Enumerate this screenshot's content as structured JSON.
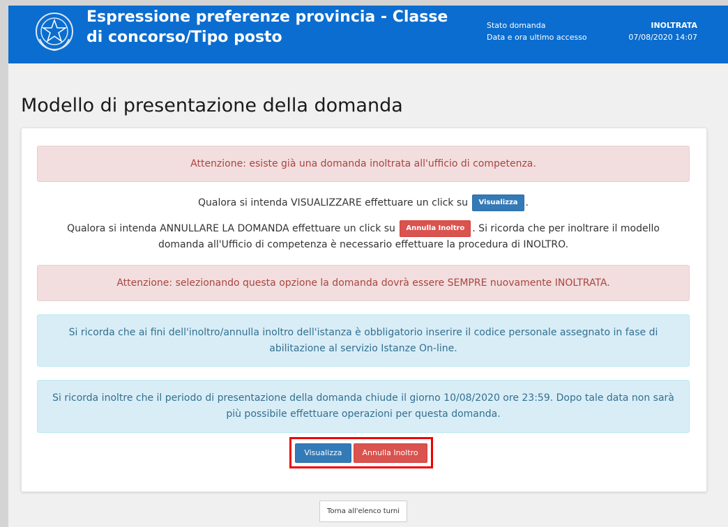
{
  "header": {
    "title": "Espressione preferenze provincia - Classe di concorso/Tipo posto",
    "status_label": "Stato domanda",
    "status_value": "INOLTRATA",
    "access_label": "Data e ora ultimo accesso",
    "access_value": "07/08/2020 14:07",
    "logo_icon": "italian-republic-emblem-icon"
  },
  "page": {
    "title": "Modello di presentazione della domanda"
  },
  "messages": {
    "alert_already_sent": "Attenzione: esiste già una domanda inoltrata all'ufficio di competenza.",
    "view_prefix": "Qualora si intenda VISUALIZZARE effettuare un click su",
    "view_suffix": ".",
    "view_button": "Visualizza",
    "cancel_prefix": "Qualora si intenda ANNULLARE LA DOMANDA effettuare un click su",
    "cancel_button": "Annulla Inoltro",
    "cancel_suffix": ". Si ricorda che per inoltrare il modello domanda all'Ufficio di competenza è necessario effettuare la procedura di INOLTRO.",
    "alert_resend": "Attenzione: selezionando questa opzione la domanda dovrà essere SEMPRE nuovamente INOLTRATA.",
    "info_code": "Si ricorda che ai fini dell'inoltro/annulla inoltro dell'istanza è obbligatorio inserire il codice personale assegnato in fase di abilitazione al servizio Istanze On-line.",
    "info_deadline": "Si ricorda inoltre che il periodo di presentazione della domanda chiude il giorno 10/08/2020 ore 23:59. Dopo tale data non sarà più possibile effettuare operazioni per questa domanda."
  },
  "actions": {
    "view_label": "Visualizza",
    "cancel_label": "Annulla Inoltro",
    "back_label": "Torna all'elenco turni"
  },
  "colors": {
    "header_bg": "#0b6dcf",
    "primary": "#337ab7",
    "danger": "#d9534f",
    "highlight_border": "#ee0000"
  }
}
